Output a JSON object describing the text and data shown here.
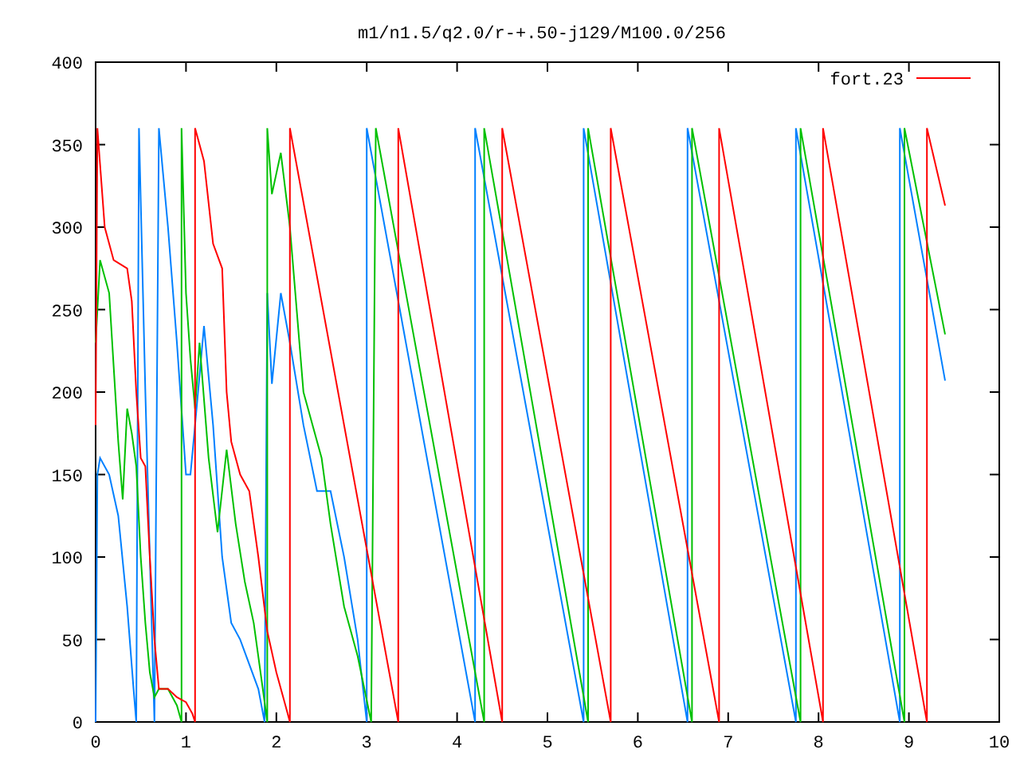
{
  "chart_data": {
    "type": "line",
    "title": "m1/n1.5/q2.0/r-+.50-j129/M100.0/256",
    "xlim": [
      0,
      10
    ],
    "ylim": [
      0,
      400
    ],
    "xticks": [
      0,
      1,
      2,
      3,
      4,
      5,
      6,
      7,
      8,
      9,
      10
    ],
    "yticks": [
      0,
      50,
      100,
      150,
      200,
      250,
      300,
      350,
      400
    ],
    "series": [
      {
        "name": "fort.23",
        "color": "#ff0000",
        "x": [
          0,
          0.02,
          0.1,
          0.2,
          0.35,
          0.4,
          0.45,
          0.5,
          0.55,
          0.6,
          0.65,
          0.7,
          0.8,
          0.9,
          1.0,
          1.07,
          1.1,
          1.1,
          1.2,
          1.3,
          1.4,
          1.45,
          1.5,
          1.6,
          1.7,
          1.8,
          1.9,
          2.0,
          2.1,
          2.15,
          2.15,
          3.35,
          3.35,
          4.5,
          4.5,
          5.7,
          5.7,
          6.9,
          6.9,
          8.05,
          8.05,
          9.2,
          9.2,
          9.4
        ],
        "values": [
          180,
          360,
          300,
          280,
          275,
          255,
          200,
          160,
          155,
          100,
          50,
          20,
          20,
          15,
          12,
          5,
          0,
          360,
          340,
          290,
          275,
          200,
          170,
          150,
          140,
          100,
          55,
          30,
          10,
          0,
          360,
          0,
          360,
          0,
          360,
          0,
          360,
          0,
          360,
          0,
          360,
          0,
          360,
          313
        ]
      },
      {
        "color": "#00c000",
        "x": [
          0,
          0.05,
          0.15,
          0.25,
          0.3,
          0.35,
          0.4,
          0.45,
          0.5,
          0.55,
          0.6,
          0.65,
          0.7,
          0.8,
          0.9,
          0.95,
          0.95,
          1.0,
          1.05,
          1.1,
          1.15,
          1.25,
          1.35,
          1.45,
          1.55,
          1.65,
          1.75,
          1.85,
          1.9,
          1.9,
          1.95,
          2.05,
          2.15,
          2.3,
          2.5,
          2.6,
          2.75,
          2.9,
          3.05,
          3.1,
          4.3,
          4.3,
          5.45,
          5.45,
          6.6,
          6.6,
          7.8,
          7.8,
          8.95,
          8.95,
          9.4
        ],
        "values": [
          230,
          280,
          260,
          170,
          135,
          190,
          175,
          155,
          100,
          60,
          30,
          15,
          20,
          20,
          10,
          0,
          360,
          260,
          220,
          190,
          230,
          160,
          115,
          165,
          120,
          85,
          60,
          20,
          0,
          360,
          320,
          345,
          300,
          200,
          160,
          120,
          70,
          40,
          0,
          360,
          0,
          360,
          0,
          360,
          0,
          360,
          0,
          360,
          0,
          360,
          235
        ]
      },
      {
        "color": "#0080ff",
        "x": [
          0,
          0.02,
          0.05,
          0.15,
          0.25,
          0.35,
          0.42,
          0.45,
          0.48,
          0.55,
          0.6,
          0.65,
          0.7,
          0.8,
          0.9,
          1.0,
          1.05,
          1.1,
          1.2,
          1.3,
          1.4,
          1.5,
          1.6,
          1.7,
          1.8,
          1.87,
          1.9,
          1.95,
          2.05,
          2.15,
          2.3,
          2.45,
          2.6,
          2.75,
          2.9,
          3.0,
          3.0,
          4.2,
          4.2,
          5.4,
          5.4,
          6.55,
          6.55,
          7.75,
          7.75,
          8.9,
          8.9,
          9.4
        ],
        "values": [
          0,
          150,
          160,
          150,
          125,
          70,
          20,
          0,
          360,
          200,
          100,
          0,
          360,
          300,
          230,
          150,
          150,
          180,
          240,
          180,
          100,
          60,
          50,
          35,
          20,
          0,
          260,
          205,
          260,
          230,
          180,
          140,
          140,
          100,
          50,
          0,
          360,
          0,
          360,
          0,
          360,
          0,
          360,
          0,
          360,
          0,
          360,
          207
        ]
      }
    ]
  }
}
